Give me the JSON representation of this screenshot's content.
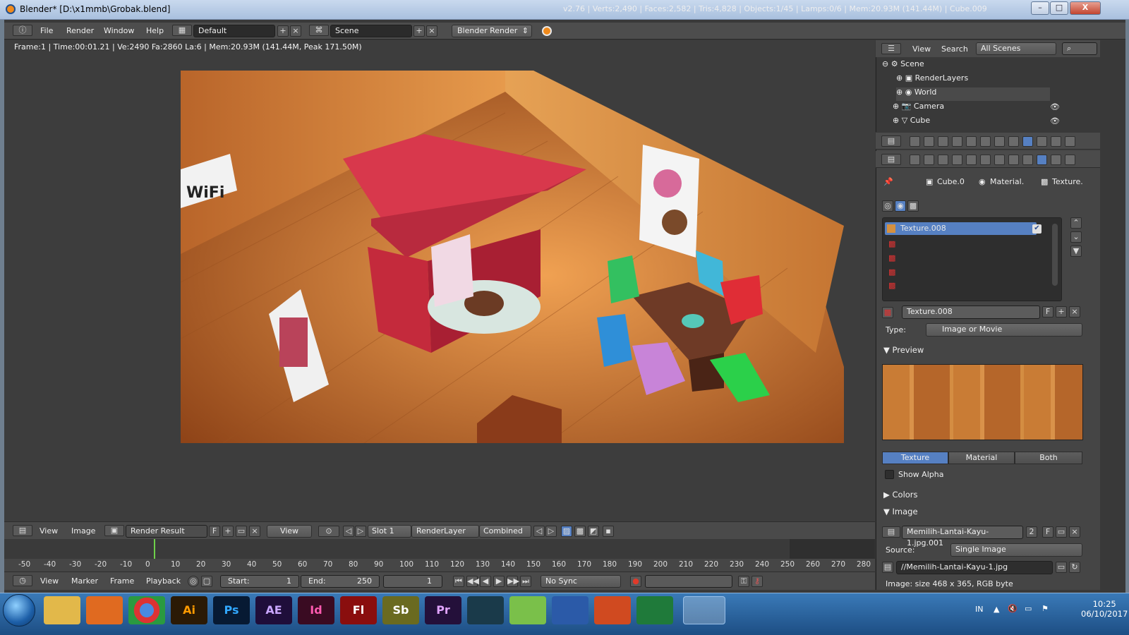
{
  "window": {
    "title": "Blender* [D:\\x1mmb\\Grobak.blend]",
    "min": "–",
    "max": "□",
    "close": "X"
  },
  "header": {
    "menus": [
      "File",
      "Render",
      "Window",
      "Help"
    ],
    "screen": "Default",
    "scene": "Scene",
    "engine": "Blender Render",
    "stats": "v2.76 | Verts:2,490 | Faces:2,582 | Tris:4,828 | Objects:1/45 | Lamps:0/6 | Mem:20.93M (141.44M) | Cube.009"
  },
  "viewport": {
    "info": "Frame:1 | Time:00:01.21 | Ve:2490 Fa:2860 La:6 | Mem:20.93M (141.44M, Peak 171.50M)"
  },
  "image_editor": {
    "view": "View",
    "image": "Image",
    "image_name": "Render Result",
    "f": "F",
    "view2": "View",
    "slot": "Slot 1",
    "layer": "RenderLayer",
    "pass": "Combined"
  },
  "timeline": {
    "ticks": [
      "-50",
      "-40",
      "-30",
      "-20",
      "-10",
      "0",
      "10",
      "20",
      "30",
      "40",
      "50",
      "60",
      "70",
      "80",
      "90",
      "100",
      "110",
      "120",
      "130",
      "140",
      "150",
      "160",
      "170",
      "180",
      "190",
      "200",
      "210",
      "220",
      "230",
      "240",
      "250",
      "260",
      "270",
      "280"
    ],
    "menus": [
      "View",
      "Marker",
      "Frame",
      "Playback"
    ],
    "start_label": "Start:",
    "start": "1",
    "end_label": "End:",
    "end": "250",
    "current": "1",
    "sync": "No Sync"
  },
  "outliner": {
    "view": "View",
    "search": "Search",
    "filter": "All Scenes",
    "items": [
      "Scene",
      "RenderLayers",
      "World",
      "Camera",
      "Cube"
    ]
  },
  "properties": {
    "breadcrumb": [
      "Cube.0",
      "Material.",
      "Texture."
    ],
    "slots": [
      "Texture.008"
    ],
    "texture_name": "Texture.008",
    "f": "F",
    "type_label": "Type:",
    "type": "Image or Movie",
    "preview": "Preview",
    "seg": [
      "Texture",
      "Material",
      "Both"
    ],
    "show_alpha": "Show Alpha",
    "colors": "Colors",
    "image_section": "Image",
    "image_name": "Memilih-Lantai-Kayu-1.jpg.001",
    "users": "2",
    "source_label": "Source:",
    "source": "Single Image",
    "path": "//Memilih-Lantai-Kayu-1.jpg",
    "image_info": "Image: size 468 x 365, RGB byte"
  },
  "render": {
    "wifi": "WiFi"
  },
  "taskbar": {
    "apps": [
      "Ai",
      "Ps",
      "AE",
      "Id",
      "Fl",
      "Sb",
      "Pr"
    ],
    "lang": "IN",
    "time": "10:25",
    "date": "06/10/2017"
  },
  "colors": {
    "accent": "#5680c2",
    "viewport_bg": "#3d3d3d",
    "panel_bg": "#454545"
  }
}
